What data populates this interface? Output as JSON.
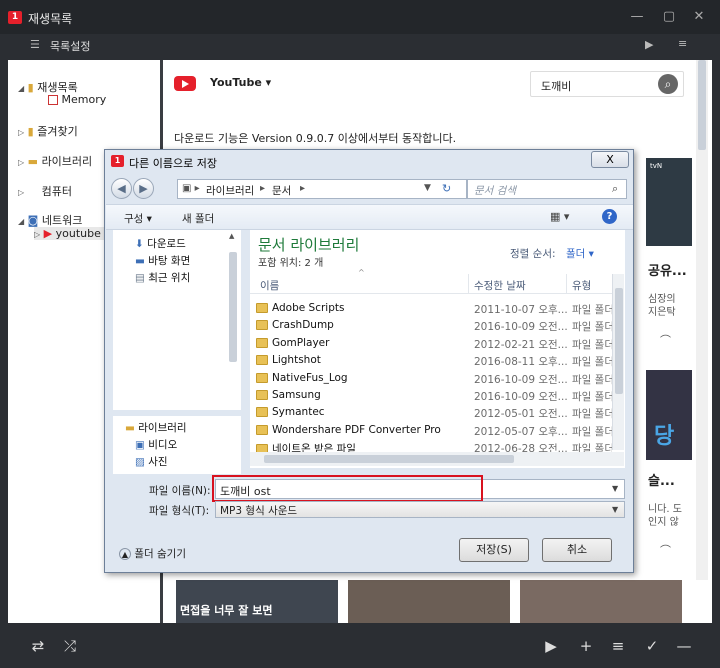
{
  "app": {
    "title": "재생목록",
    "toolbar_label": "목록설정",
    "search_value": "도깨비",
    "source_label": "YouTube",
    "notice": "다운로드 기능은 Version 0.9.0.7 이상에서부터 동작합니다."
  },
  "sidebar": {
    "items": [
      {
        "label": "재생목록"
      },
      {
        "label": "Memory"
      },
      {
        "label": "즐겨찾기"
      },
      {
        "label": "라이브러리"
      },
      {
        "label": "컴퓨터"
      },
      {
        "label": "네트워크"
      },
      {
        "label": "youtube"
      }
    ]
  },
  "content": {
    "card1_title": "공유...",
    "card1_desc1": "심장의",
    "card1_desc2": "지은탁",
    "card2_thumb_text": "당",
    "card2_title": "슬...",
    "card2_desc1": "니다. 도",
    "card2_desc2": "인지 않",
    "bottom_thumb_text": "면접을 너무 잘 보면",
    "tvn": "tvN"
  },
  "dialog": {
    "title": "다른 이름으로 저장",
    "close": "X",
    "crumbs": [
      "라이브러리",
      "문서"
    ],
    "search_placeholder": "문서 검색",
    "organize": "구성 ▾",
    "new_folder": "새 폴더",
    "left_items": [
      {
        "label": "다운로드"
      },
      {
        "label": "바탕 화면"
      },
      {
        "label": "최근 위치"
      },
      {
        "label": "라이브러리"
      },
      {
        "label": "비디오"
      },
      {
        "label": "사진"
      }
    ],
    "library_title": "문서 라이브러리",
    "library_sub": "포함 위치: 2 개",
    "sort_label": "정렬 순서:",
    "sort_value": "폴더 ▾",
    "columns": {
      "name": "이름",
      "date": "수정한 날짜",
      "type": "유형"
    },
    "files": [
      {
        "name": "Adobe Scripts",
        "date": "2011-10-07 오후...",
        "type": "파일 폴더"
      },
      {
        "name": "CrashDump",
        "date": "2016-10-09 오전...",
        "type": "파일 폴더"
      },
      {
        "name": "GomPlayer",
        "date": "2012-02-21 오전...",
        "type": "파일 폴더"
      },
      {
        "name": "Lightshot",
        "date": "2016-08-11 오후...",
        "type": "파일 폴더"
      },
      {
        "name": "NativeFus_Log",
        "date": "2016-10-09 오전...",
        "type": "파일 폴더"
      },
      {
        "name": "Samsung",
        "date": "2016-10-09 오전...",
        "type": "파일 폴더"
      },
      {
        "name": "Symantec",
        "date": "2012-05-01 오전...",
        "type": "파일 폴더"
      },
      {
        "name": "Wondershare PDF Converter Pro",
        "date": "2012-05-07 오후...",
        "type": "파일 폴더"
      },
      {
        "name": "네이트온 받은 파일",
        "date": "2012-06-28 오전...",
        "type": "파일 폴더"
      }
    ],
    "filename_label": "파일 이름(N):",
    "filename_value": "도깨비 ost",
    "filetype_label": "파일 형식(T):",
    "filetype_value": "MP3 형식 사운드",
    "hide_folders": "폴더 숨기기",
    "save": "저장(S)",
    "cancel": "취소"
  },
  "colors": {
    "accent": "#e5202b",
    "highlight_box": "#d8121f",
    "library_title": "#1e7a3a"
  }
}
